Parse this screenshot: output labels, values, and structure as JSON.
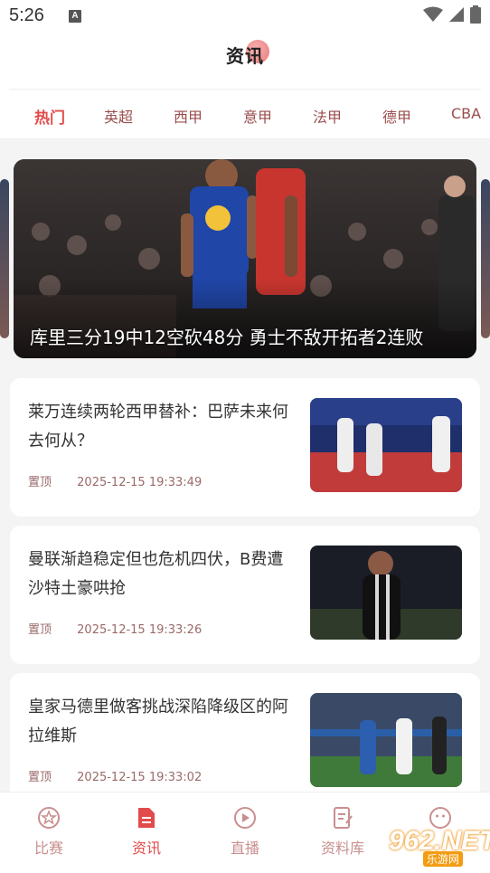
{
  "status_bar": {
    "time": "5:26",
    "notification_icon": "A"
  },
  "header": {
    "title": "资讯"
  },
  "tabs": [
    {
      "label": "热门",
      "active": true
    },
    {
      "label": "英超",
      "active": false
    },
    {
      "label": "西甲",
      "active": false
    },
    {
      "label": "意甲",
      "active": false
    },
    {
      "label": "法甲",
      "active": false
    },
    {
      "label": "德甲",
      "active": false
    },
    {
      "label": "CBA",
      "active": false
    }
  ],
  "banner": {
    "caption": "库里三分19中12空砍48分 勇士不敌开拓者2连败"
  },
  "news": [
    {
      "title": "莱万连续两轮西甲替补：巴萨未来何去何从？",
      "tag": "置顶",
      "time": "2025-12-15 19:33:49"
    },
    {
      "title": "曼联渐趋稳定但也危机四伏，B费遭沙特土豪哄抢",
      "tag": "置顶",
      "time": "2025-12-15 19:33:26"
    },
    {
      "title": "皇家马德里做客挑战深陷降级区的阿拉维斯",
      "tag": "置顶",
      "time": "2025-12-15 19:33:02"
    }
  ],
  "bottom_nav": [
    {
      "label": "比赛",
      "icon": "trophy-badge-icon",
      "active": false
    },
    {
      "label": "资讯",
      "icon": "document-icon",
      "active": true
    },
    {
      "label": "直播",
      "icon": "play-circle-icon",
      "active": false
    },
    {
      "label": "资料库",
      "icon": "edit-note-icon",
      "active": false
    },
    {
      "label": "我的",
      "icon": "smiley-icon",
      "active": false
    }
  ],
  "watermark": {
    "text": "962.NET",
    "sub": "乐游网"
  },
  "colors": {
    "accent": "#e24b4b",
    "tab_text": "#9a4d4d",
    "meta_text": "#9a6a6a",
    "background": "#f4f4f4"
  }
}
